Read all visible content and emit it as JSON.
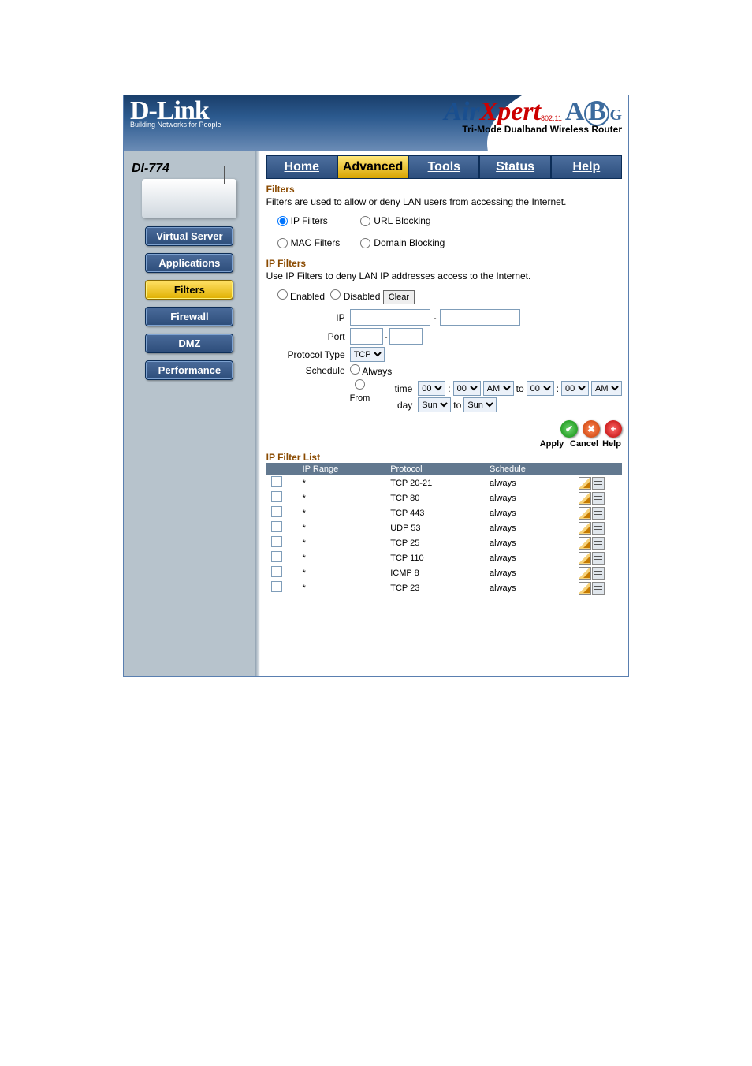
{
  "brand": {
    "name": "D-Link",
    "tagline": "Building Networks for People",
    "product_line1": "Air",
    "product_line2": "Xpert",
    "sub": "802.11",
    "abg": "ABG",
    "product_desc": "Tri-Mode Dualband Wireless Router"
  },
  "model": "DI-774",
  "sidebar": {
    "items": [
      {
        "label": "Virtual Server"
      },
      {
        "label": "Applications"
      },
      {
        "label": "Filters"
      },
      {
        "label": "Firewall"
      },
      {
        "label": "DMZ"
      },
      {
        "label": "Performance"
      }
    ]
  },
  "tabs": {
    "home": "Home",
    "advanced": "Advanced",
    "tools": "Tools",
    "status": "Status",
    "help": "Help"
  },
  "filters": {
    "title": "Filters",
    "desc": "Filters are used to allow or deny LAN users from accessing the Internet.",
    "opt_ip": "IP Filters",
    "opt_mac": "MAC Filters",
    "opt_url": "URL Blocking",
    "opt_domain": "Domain Blocking"
  },
  "ipfilters": {
    "title": "IP Filters",
    "desc": "Use IP Filters to deny LAN IP addresses access to the Internet.",
    "enabled": "Enabled",
    "disabled": "Disabled",
    "clear": "Clear",
    "lab_ip": "IP",
    "lab_port": "Port",
    "lab_proto": "Protocol Type",
    "proto_val": "TCP",
    "lab_sched": "Schedule",
    "sched_always": "Always",
    "sched_from": "From",
    "time_lab": "time",
    "day_lab": "day",
    "to": "to",
    "h1": "00",
    "m1": "00",
    "ap1": "AM",
    "h2": "00",
    "m2": "00",
    "ap2": "AM",
    "day1": "Sun",
    "day2": "Sun",
    "dash": "-",
    "dot": "."
  },
  "actions": {
    "apply": "Apply",
    "cancel": "Cancel",
    "help": "Help"
  },
  "list": {
    "title": "IP Filter List",
    "cols": {
      "ip": "IP Range",
      "proto": "Protocol",
      "sched": "Schedule"
    },
    "rows": [
      {
        "ip": "*",
        "proto": "TCP 20-21",
        "sched": "always"
      },
      {
        "ip": "*",
        "proto": "TCP 80",
        "sched": "always"
      },
      {
        "ip": "*",
        "proto": "TCP 443",
        "sched": "always"
      },
      {
        "ip": "*",
        "proto": "UDP 53",
        "sched": "always"
      },
      {
        "ip": "*",
        "proto": "TCP 25",
        "sched": "always"
      },
      {
        "ip": "*",
        "proto": "TCP 110",
        "sched": "always"
      },
      {
        "ip": "*",
        "proto": "ICMP 8",
        "sched": "always"
      },
      {
        "ip": "*",
        "proto": "TCP 23",
        "sched": "always"
      }
    ]
  },
  "glyphs": {
    "check": "✔",
    "x": "✖",
    "plus": "+",
    "colon": ":"
  }
}
